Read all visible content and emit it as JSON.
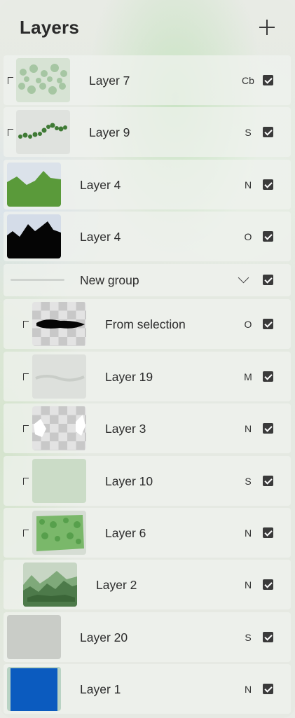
{
  "header": {
    "title": "Layers",
    "add_icon": "plus-icon"
  },
  "colors": {
    "check": "#3a3a3a",
    "layer1_fill": "#0b5bbf",
    "mountain_green": "#5a9a3a"
  },
  "layers": [
    {
      "name": "Layer 7",
      "blend": "Cb",
      "visible": true,
      "clipped": true,
      "thumb": "green-grass-texture"
    },
    {
      "name": "Layer 9",
      "blend": "S",
      "visible": true,
      "clipped": true,
      "thumb": "green-foliage-band"
    },
    {
      "name": "Layer 4",
      "blend": "N",
      "visible": true,
      "clipped": false,
      "thumb": "green-mountains"
    },
    {
      "name": "Layer 4",
      "blend": "O",
      "visible": true,
      "clipped": false,
      "thumb": "black-mountains"
    },
    {
      "name": "New group",
      "blend": "",
      "visible": true,
      "clipped": false,
      "thumb": "group"
    },
    {
      "name": "From selection",
      "blend": "O",
      "visible": true,
      "clipped": true,
      "thumb": "black-stroke"
    },
    {
      "name": "Layer 19",
      "blend": "M",
      "visible": true,
      "clipped": true,
      "thumb": "light-grey-texture"
    },
    {
      "name": "Layer 3",
      "blend": "N",
      "visible": true,
      "clipped": true,
      "thumb": "white-shapes"
    },
    {
      "name": "Layer 10",
      "blend": "S",
      "visible": true,
      "clipped": true,
      "thumb": "pale-green"
    },
    {
      "name": "Layer 6",
      "blend": "N",
      "visible": true,
      "clipped": true,
      "thumb": "green-texture"
    },
    {
      "name": "Layer 2",
      "blend": "N",
      "visible": true,
      "clipped": false,
      "thumb": "green-mountain-scene"
    },
    {
      "name": "Layer 20",
      "blend": "S",
      "visible": true,
      "clipped": false,
      "thumb": "grey-fill"
    },
    {
      "name": "Layer 1",
      "blend": "N",
      "visible": true,
      "clipped": false,
      "thumb": "blue-fill"
    }
  ]
}
